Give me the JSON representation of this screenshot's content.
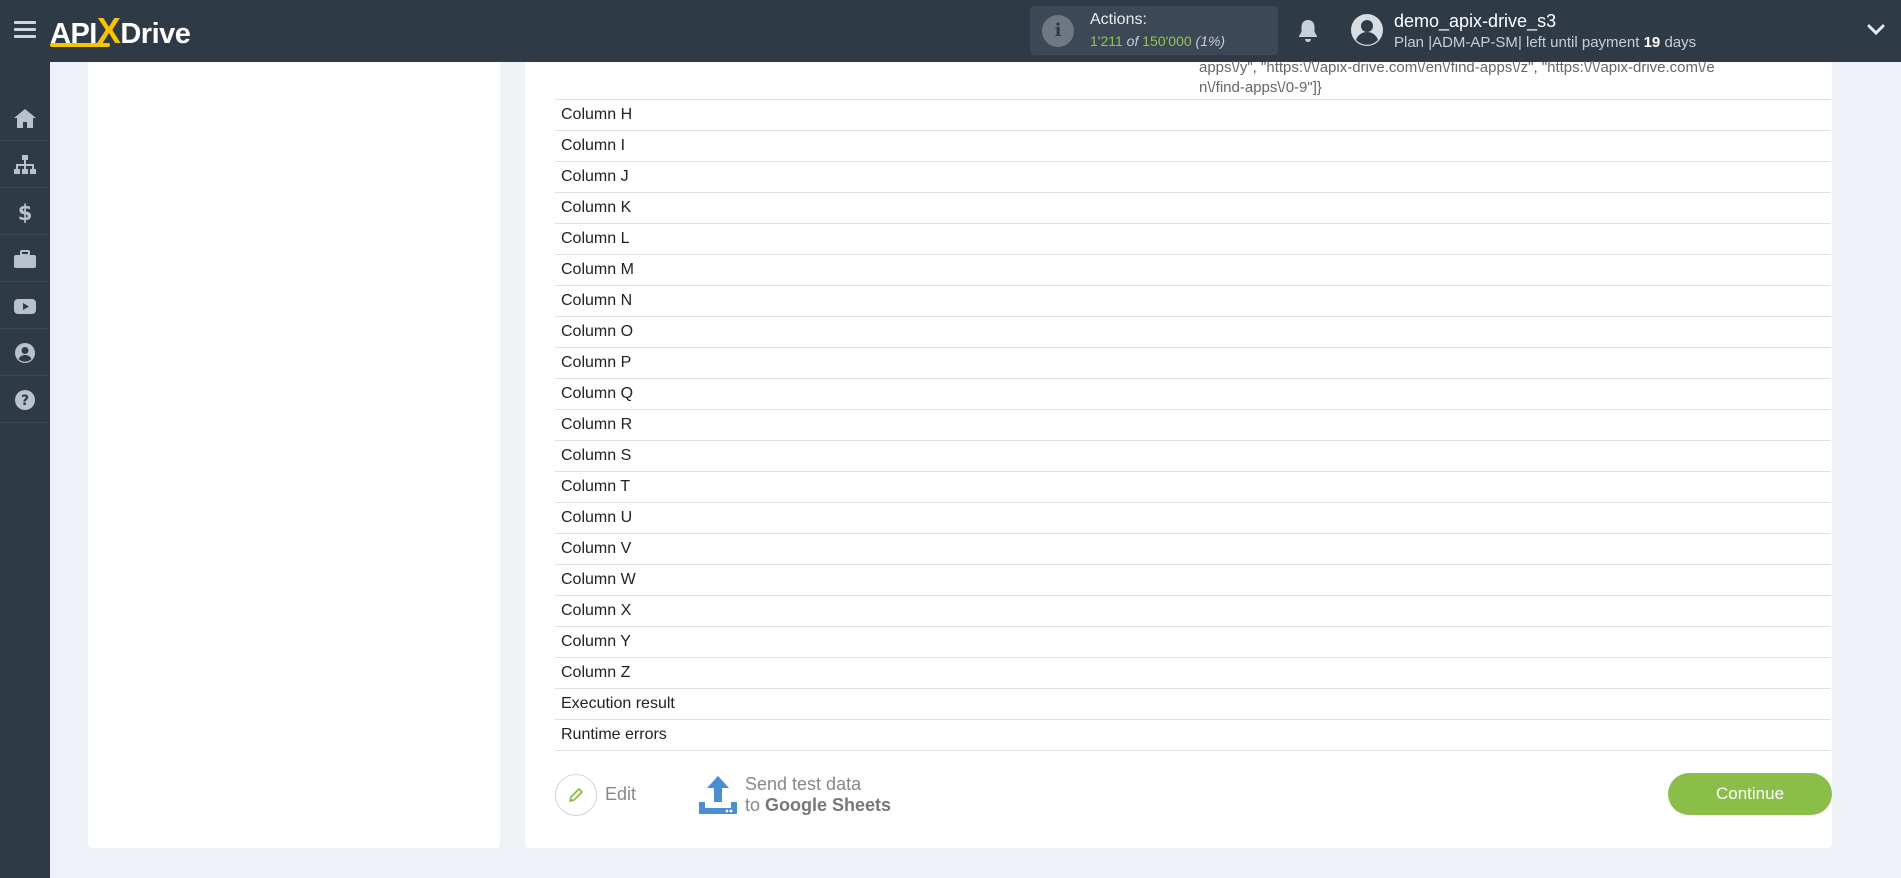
{
  "header": {
    "logo_text_left": "API",
    "logo_text_x": "X",
    "logo_text_right": "Drive",
    "actions_label": "Actions:",
    "actions_used": "1'211",
    "actions_of": "of",
    "actions_total": "150'000",
    "actions_percent": "(1%)",
    "username": "demo_apix-drive_s3",
    "plan_prefix": "Plan |",
    "plan_code": "ADM-AP-SM",
    "plan_middle": "| left until payment",
    "plan_days": "19",
    "plan_suffix": "days"
  },
  "sidenav": {
    "items": [
      "home-icon",
      "sitemap-icon",
      "dollar-icon",
      "briefcase-icon",
      "youtube-icon",
      "user-icon",
      "help-icon"
    ]
  },
  "main": {
    "overflow_text": "apps\\/y\", \"https:\\/\\/apix-drive.com\\/en\\/find-apps\\/z\", \"https:\\/\\/apix-drive.com\\/en\\/find-apps\\/0-9\"]}",
    "rows": [
      "Column H",
      "Column I",
      "Column J",
      "Column K",
      "Column L",
      "Column M",
      "Column N",
      "Column O",
      "Column P",
      "Column Q",
      "Column R",
      "Column S",
      "Column T",
      "Column U",
      "Column V",
      "Column W",
      "Column X",
      "Column Y",
      "Column Z",
      "Execution result",
      "Runtime errors"
    ],
    "edit_label": "Edit",
    "send_line1": "Send test data",
    "send_line2_prefix": "to",
    "send_line2_target": "Google Sheets",
    "continue_label": "Continue"
  },
  "colors": {
    "topbar": "#2f3a47",
    "accent_green": "#8bbd49",
    "logo_yellow": "#f4c400",
    "send_icon_blue": "#4a8ed1"
  }
}
